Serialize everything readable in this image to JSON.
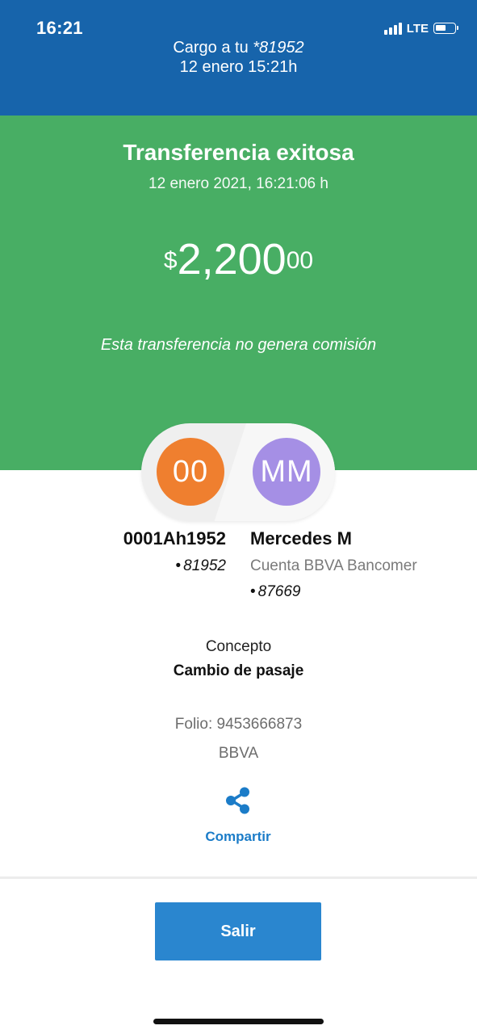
{
  "status_bar": {
    "time": "16:21",
    "network": "LTE"
  },
  "header": {
    "charge_prefix": "Cargo a tu",
    "charge_account": "*81952",
    "charge_date": "12 enero 15:21h"
  },
  "result": {
    "title": "Transferencia exitosa",
    "datetime": "12 enero 2021, 16:21:06 h",
    "amount_currency": "$",
    "amount_main": "2,200",
    "amount_cents": "00",
    "commission_note": "Esta transferencia no genera comisión"
  },
  "sender": {
    "initials": "00",
    "name": "0001Ah1952",
    "account": "81952",
    "avatar_color": "#ef7f2f"
  },
  "recipient": {
    "initials": "MM",
    "name": "Mercedes M",
    "bank": "Cuenta BBVA Bancomer",
    "account": "87669",
    "avatar_color": "#a58fe5"
  },
  "details": {
    "concept_label": "Concepto",
    "concept_value": "Cambio de pasaje",
    "folio": "Folio: 9453666873",
    "bank": "BBVA"
  },
  "actions": {
    "share_label": "Compartir",
    "share_icon": "share-icon",
    "exit_label": "Salir"
  },
  "colors": {
    "header_blue": "#1764ab",
    "success_green": "#48ae64",
    "action_blue": "#2a86cf"
  }
}
